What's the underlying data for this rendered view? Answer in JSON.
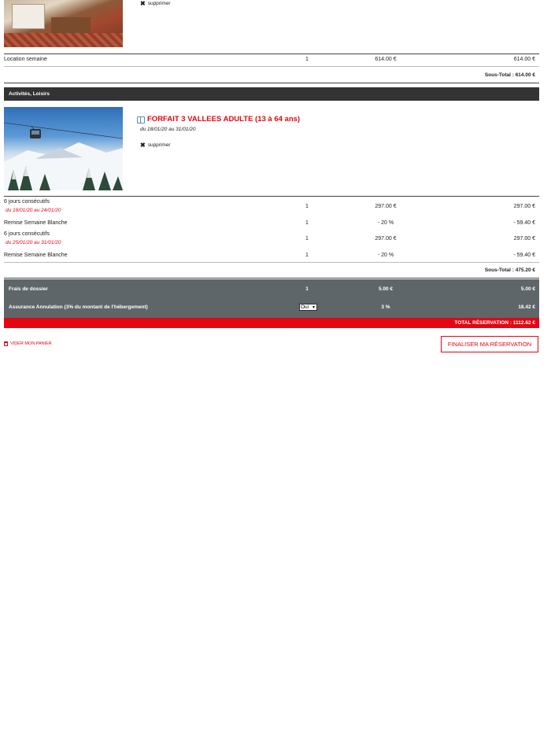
{
  "room": {
    "delete_label": "supprimer"
  },
  "lodging": {
    "row": {
      "label": "Location semaine",
      "qty": "1",
      "unit": "614.00 €",
      "total": "614.00 €"
    },
    "subtotal": "Sous-Total : 614.00 €"
  },
  "activities": {
    "section_title": "Activités, Loisirs",
    "product_title": "FORFAIT 3 VALLEES ADULTE (13 à 64 ans)",
    "product_dates": "du 18/01/20 au 31/01/20",
    "delete_label": "supprimer",
    "rows": [
      {
        "label": "6 jours consécutifs",
        "dates": "du 18/01/20 au 24/01/20",
        "qty": "1",
        "unit": "297.00 €",
        "total": "297.00 €"
      },
      {
        "label": "Remise Semaine Blanche",
        "dates": "",
        "qty": "1",
        "unit": "- 20 %",
        "total": "- 59.40 €"
      },
      {
        "label": "6 jours consécutifs",
        "dates": "du 25/01/20 au 31/01/20",
        "qty": "1",
        "unit": "297.00 €",
        "total": "297.00 €"
      },
      {
        "label": "Remise Semaine Blanche",
        "dates": "",
        "qty": "1",
        "unit": "- 20 %",
        "total": "- 59.40 €"
      }
    ],
    "subtotal": "Sous-Total : 475.20 €"
  },
  "fees": {
    "rows": [
      {
        "label": "Frais de dossier",
        "qty": "1",
        "unit": "5.00 €",
        "total": "5.00 €"
      },
      {
        "label": "Assurance Annulation (3% du montant de l'hébergement)",
        "select_value": "Oui",
        "unit": "3 %",
        "total": "18.42 €"
      }
    ],
    "grand_total": "TOTAL RÉSERVATION : 1112.62 €"
  },
  "actions": {
    "empty_cart": "VIDER MON PANIER",
    "finalize": "FINALISER MA RÉSERVATION"
  },
  "colors": {
    "accent": "#e30613",
    "section_header_bg": "#333333",
    "fees_bg": "#5f6669"
  }
}
